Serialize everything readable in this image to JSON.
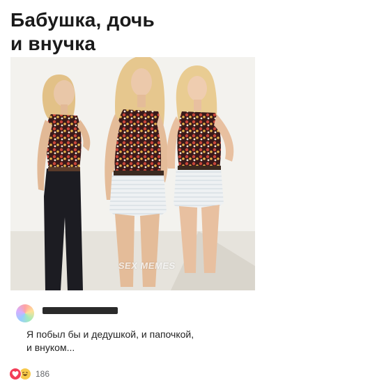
{
  "post": {
    "title_line1": "Бабушка, дочь",
    "title_line2": "и внучка",
    "watermark": "SEX MEMES",
    "comment": {
      "text_line1": "Я побыл бы и дедушкой, и папочкой,",
      "text_line2": "и внуком..."
    }
  },
  "reactions": {
    "icons": [
      "heart-icon",
      "haha-icon"
    ],
    "count": "186"
  },
  "colors": {
    "heart": "#f33e58",
    "haha": "#f7c94b",
    "count_text": "#65676b"
  }
}
